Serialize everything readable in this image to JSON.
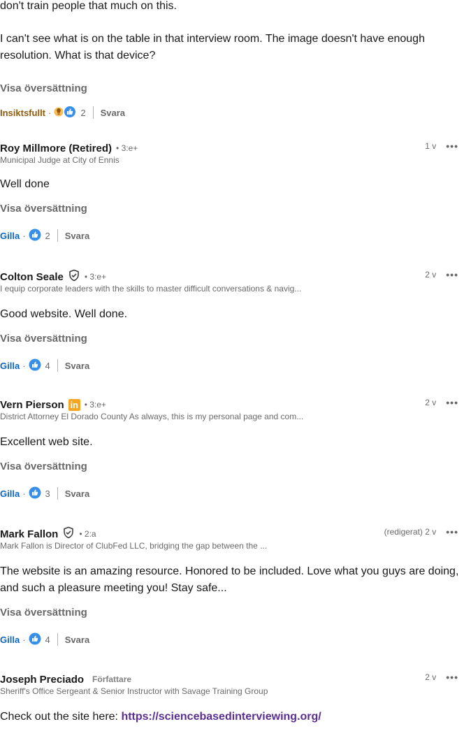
{
  "top": {
    "line1": "don't train people that much on this.",
    "paragraph2": "I can't see what is on the table in that interview room. The image doesn't have enough resolution. What is that device?",
    "translate": "Visa översättning",
    "reaction_label": "Insiktsfullt",
    "reaction_count": "2",
    "reply": "Svara"
  },
  "comments": [
    {
      "name": "Roy Millmore (Retired)",
      "degree": "• 3:e+",
      "headline": "Municipal Judge at City of Ennis",
      "time": "1 v",
      "text": "Well done",
      "translate": "Visa översättning",
      "reaction_label": "Gilla",
      "reaction_count": "2",
      "reply": "Svara"
    },
    {
      "name": "Colton Seale",
      "degree": "• 3:e+",
      "headline": "I equip corporate leaders with the skills to master difficult conversations & navig...",
      "time": "2 v",
      "text": "Good website. Well done.",
      "translate": "Visa översättning",
      "reaction_label": "Gilla",
      "reaction_count": "4",
      "reply": "Svara"
    },
    {
      "name": "Vern Pierson",
      "degree": "• 3:e+",
      "badge": "in",
      "headline": "District Attorney El Dorado County As always, this is my personal page and com...",
      "time": "2 v",
      "text": "Excellent web site.",
      "translate": "Visa översättning",
      "reaction_label": "Gilla",
      "reaction_count": "3",
      "reply": "Svara"
    },
    {
      "name": "Mark Fallon",
      "degree": "• 2:a",
      "headline": "Mark Fallon is Director of ClubFed LLC, bridging the gap between the ...",
      "time": "(redigerat) 2 v",
      "text": "The website is an amazing resource. Honored to be included. Love what you guys are doing, and such a pleasure meeting you! Stay safe...",
      "translate": "Visa översättning",
      "reaction_label": "Gilla",
      "reaction_count": "4",
      "reply": "Svara"
    },
    {
      "name": "Joseph Preciado",
      "author_badge": "Författare",
      "headline": "Sheriff's Office Sergeant & Senior Instructor with Savage Training Group",
      "time": "2 v",
      "text_prefix": "Check out the site here: ",
      "link": "https://sciencebasedinterviewing.org/"
    }
  ],
  "colors": {
    "like_blue": "#0a66c2",
    "insight_gold": "#915907",
    "linkedin_orange": "#f5a623",
    "link_purple": "#5b2e91"
  },
  "icons": {
    "more": "•••"
  }
}
